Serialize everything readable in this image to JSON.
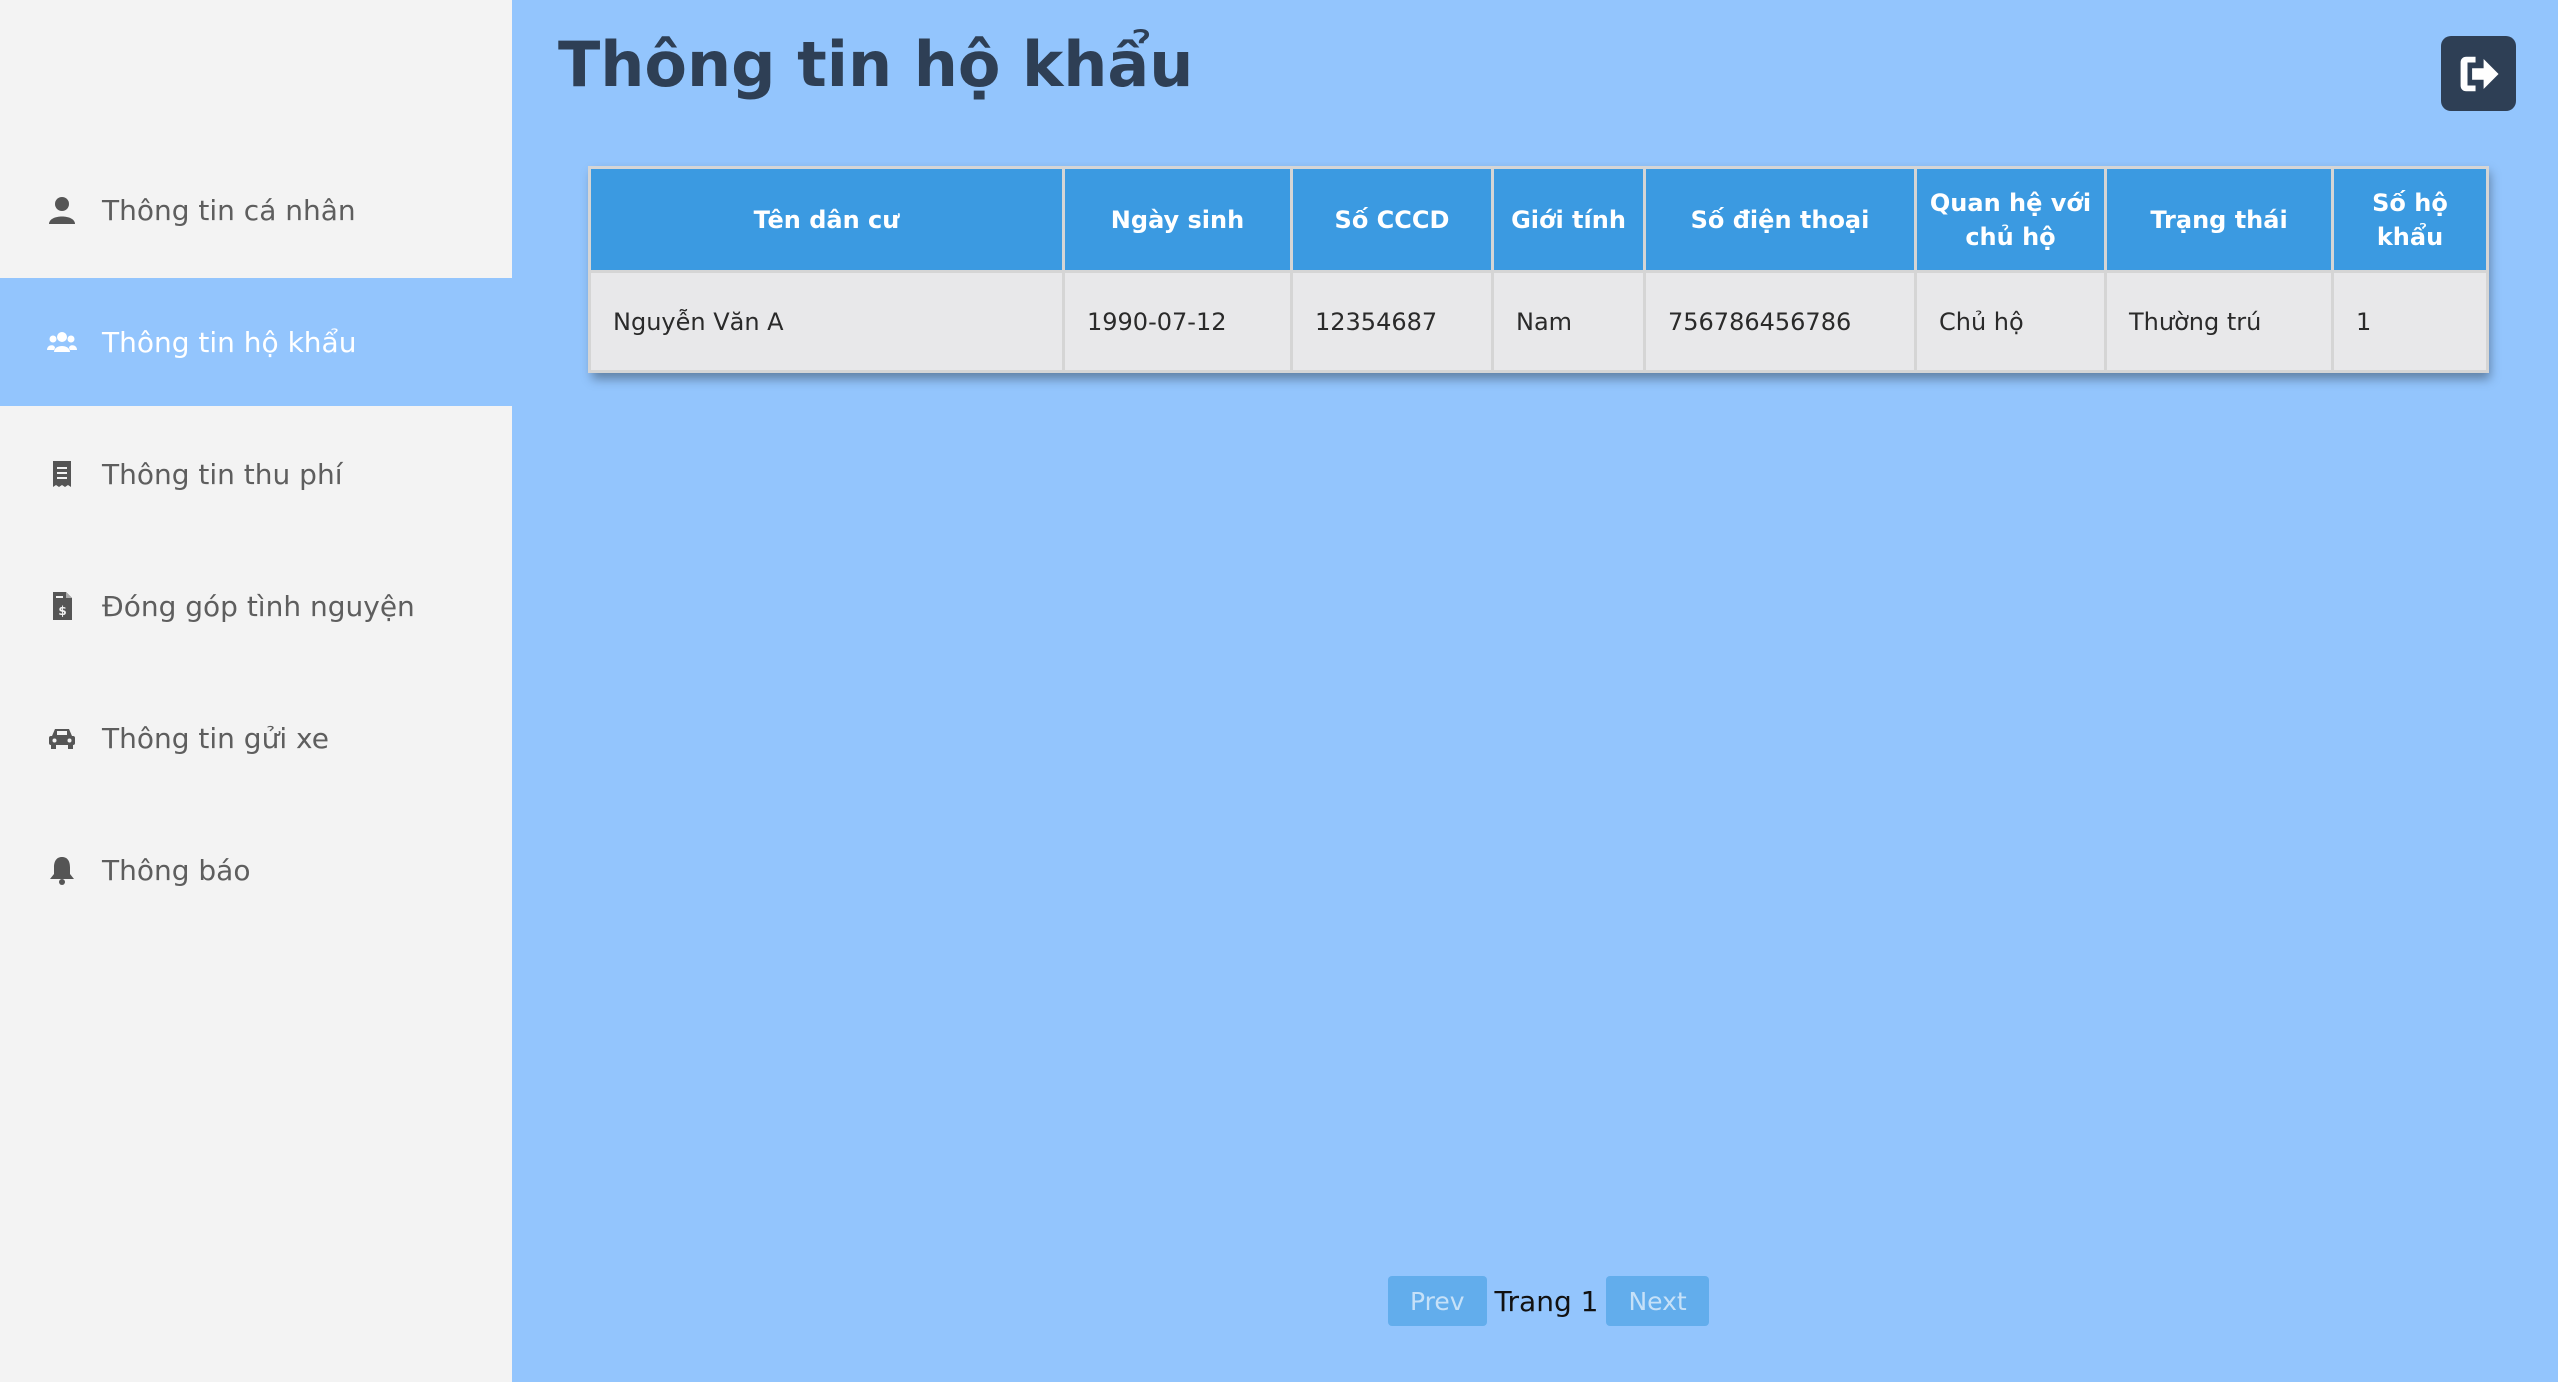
{
  "sidebar": {
    "items": [
      {
        "label": "Thông tin cá nhân",
        "icon": "user-icon",
        "active": false
      },
      {
        "label": "Thông tin hộ khẩu",
        "icon": "users-icon",
        "active": true
      },
      {
        "label": "Thông tin thu phí",
        "icon": "receipt-icon",
        "active": false
      },
      {
        "label": "Đóng góp tình nguyện",
        "icon": "invoice-dollar-icon",
        "active": false
      },
      {
        "label": "Thông tin gửi xe",
        "icon": "car-icon",
        "active": false
      },
      {
        "label": "Thông báo",
        "icon": "bell-icon",
        "active": false
      }
    ]
  },
  "header": {
    "title": "Thông tin hộ khẩu",
    "logout_icon": "sign-out-icon"
  },
  "table": {
    "columns": [
      "Tên dân cư",
      "Ngày sinh",
      "Số CCCD",
      "Giới tính",
      "Số điện thoại",
      "Quan hệ với chủ hộ",
      "Trạng thái",
      "Số hộ khẩu"
    ],
    "rows": [
      [
        "Nguyễn Văn A",
        "1990-07-12",
        "12354687",
        "Nam",
        "756786456786",
        "Chủ hộ",
        "Thường trú",
        "1"
      ]
    ]
  },
  "pagination": {
    "prev_label": "Prev",
    "page_label": "Trang 1",
    "next_label": "Next"
  },
  "colors": {
    "sidebar_bg": "#f3f3f3",
    "main_bg": "#93c5fd",
    "header_cell": "#3b9ae1",
    "title_text": "#2e3f55",
    "button_bg": "#62adec"
  }
}
